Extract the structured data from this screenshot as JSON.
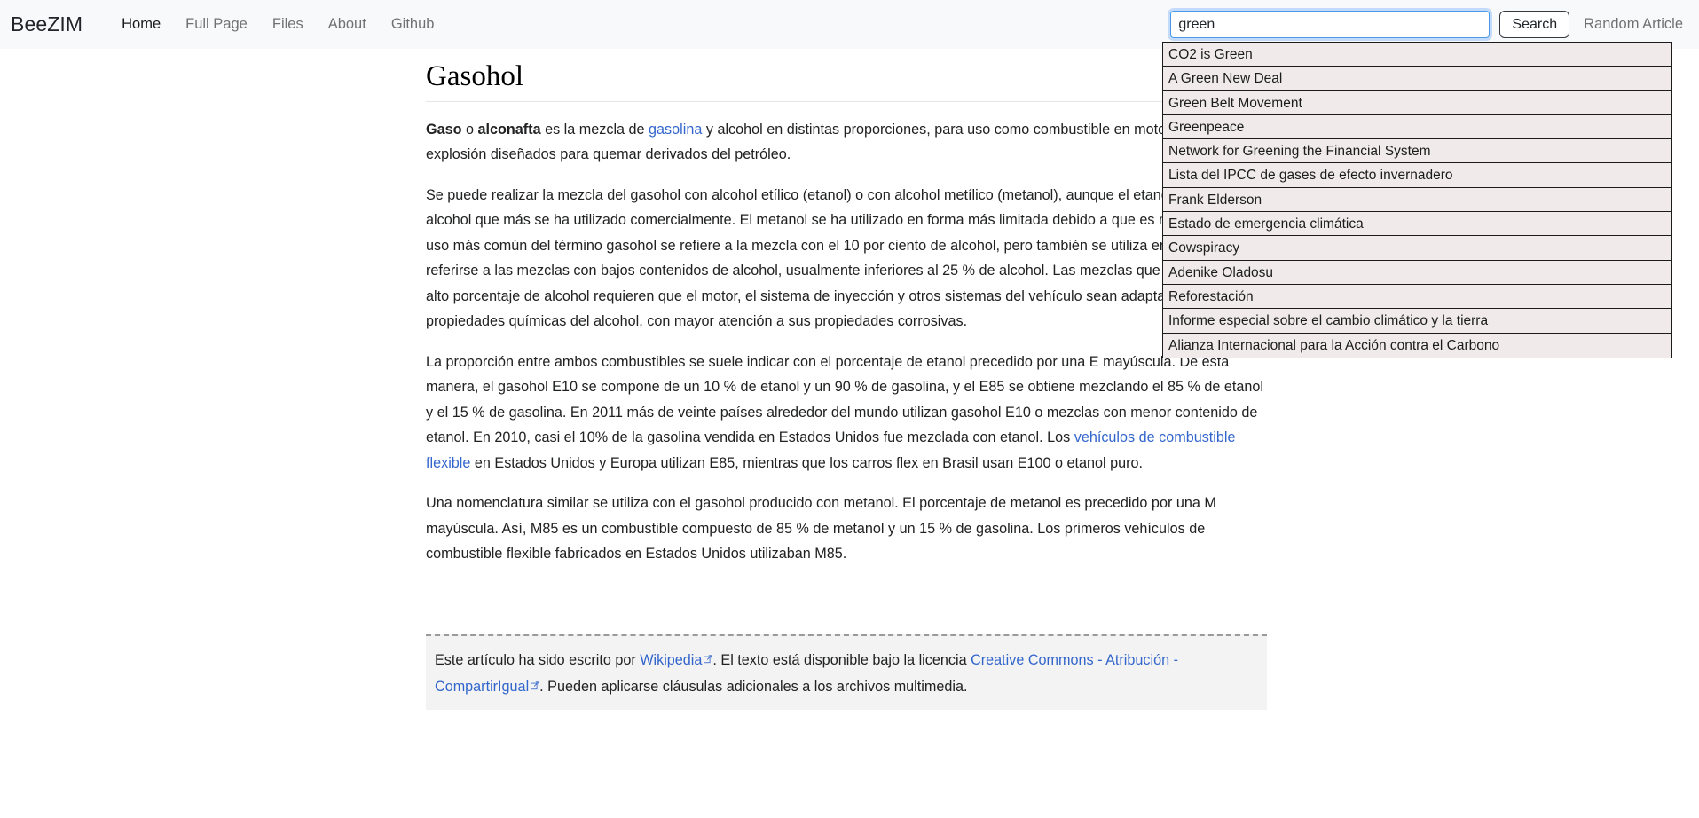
{
  "navbar": {
    "brand": "BeeZIM",
    "links": [
      {
        "label": "Home",
        "active": true
      },
      {
        "label": "Full Page",
        "active": false
      },
      {
        "label": "Files",
        "active": false
      },
      {
        "label": "About",
        "active": false
      },
      {
        "label": "Github",
        "active": false
      }
    ],
    "search": {
      "value": "green",
      "placeholder": "Search",
      "button_label": "Search"
    },
    "random_article_label": "Random Article"
  },
  "suggestions": [
    "CO2 is Green",
    "A Green New Deal",
    "Green Belt Movement",
    "Greenpeace",
    "Network for Greening the Financial System",
    "Lista del IPCC de gases de efecto invernadero",
    "Frank Elderson",
    "Estado de emergencia climática",
    "Cowspiracy",
    "Adenike Oladosu",
    "Reforestación",
    "Informe especial sobre el cambio climático y la tierra",
    "Alianza Internacional para la Acción contra el Carbono"
  ],
  "article": {
    "title": "Gasohol",
    "p1": {
      "bold1": "Gaso",
      "mid1": " o ",
      "bold2": "alconafta",
      "mid2": " es la mezcla de ",
      "link": "gasolina",
      "rest": " y alcohol en distintas proporciones, para uso como combustible en motores de explosión diseñados para quemar derivados del petróleo."
    },
    "p2": "Se puede realizar la mezcla del gasohol con alcohol etílico (etanol) o con alcohol metílico (metanol), aunque el etanol es el tipo de alcohol que más se ha utilizado comercialmente. El metanol se ha utilizado en forma más limitada debido a que es más tóxico. El uso más común del término gasohol se refiere a la mezcla con el 10 por ciento de alcohol, pero también se utiliza en general para referirse a las mezclas con bajos contenidos de alcohol, usualmente inferiores al 25 % de alcohol. Las mezclas que contienen un alto porcentaje de alcohol requieren que el motor, el sistema de inyección y otros sistemas del vehículo sean adaptados a las propiedades químicas del alcohol, con mayor atención a sus propiedades corrosivas.",
    "p3": {
      "before": "La proporción entre ambos combustibles se suele indicar con el porcentaje de etanol precedido por una E mayúscula. De esta manera, el gasohol E10 se compone de un 10 % de etanol y un 90 % de gasolina, y el E85 se obtiene mezclando el 85 % de etanol y el 15 % de gasolina. En 2011 más de veinte países alrededor del mundo utilizan gasohol E10 o mezclas con menor contenido de etanol. En 2010, casi el 10% de la gasolina vendida en Estados Unidos fue mezclada con etanol. Los ",
      "link": "vehículos de combustible flexible",
      "after": " en Estados Unidos y Europa utilizan E85, mientras que los carros flex en Brasil usan E100 o etanol puro."
    },
    "p4": "Una nomenclatura similar se utiliza con el gasohol producido con metanol. El porcentaje de metanol es precedido por una M mayúscula. Así, M85 es un combustible compuesto de 85 % de metanol y un 15 % de gasolina. Los primeros vehículos de combustible flexible fabricados en Estados Unidos utilizaban M85."
  },
  "attribution": {
    "part1": "Este artículo ha sido escrito por ",
    "link1": "Wikipedia",
    "part2": ". El texto está disponible bajo la licencia ",
    "link2": "Creative Commons - Atribución - CompartirIgual",
    "part3": ". Pueden aplicarse cláusulas adicionales a los archivos multimedia."
  },
  "colors": {
    "navbar_bg": "#f8f9fa",
    "page_bg": "#ffffff",
    "link": "#3366cc",
    "suggestion_bg": "#f0eaea",
    "suggestion_border": "#1c1c1c",
    "focus_ring": "#4a9ae8",
    "attribution_bg": "#f3f3f3"
  }
}
